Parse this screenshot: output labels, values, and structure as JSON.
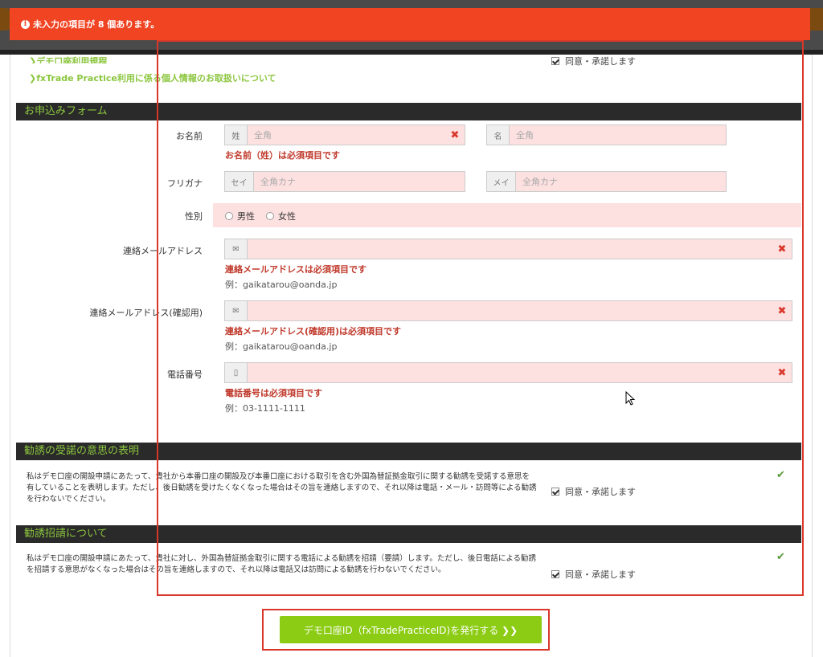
{
  "alert": {
    "icon": "info-icon",
    "text": "未入力の項目が 8 個あります。"
  },
  "links": {
    "terms": "デモ口座利用規程",
    "privacy": "fxTrade Practice利用に係る個人情報のお取扱いについて"
  },
  "agree_label": "同意・承諾します",
  "sections": {
    "form": "お申込みフォーム",
    "solicitation": "勧誘の受諾の意思の表明",
    "invitation": "勧誘招請について"
  },
  "form": {
    "name": {
      "label": "お名前",
      "last_addon": "姓",
      "last_placeholder": "全角",
      "first_addon": "名",
      "first_placeholder": "全角",
      "error": "お名前（姓）は必須項目です"
    },
    "furigana": {
      "label": "フリガナ",
      "last_addon": "セイ",
      "last_placeholder": "全角カナ",
      "first_addon": "メイ",
      "first_placeholder": "全角カナ"
    },
    "gender": {
      "label": "性別",
      "options": [
        "男性",
        "女性"
      ]
    },
    "email": {
      "label": "連絡メールアドレス",
      "error": "連絡メールアドレスは必須項目です",
      "example": "例：gaikatarou@oanda.jp"
    },
    "email_confirm": {
      "label": "連絡メールアドレス(確認用)",
      "error": "連絡メールアドレス(確認用)は必須項目です",
      "example": "例：gaikatarou@oanda.jp"
    },
    "phone": {
      "label": "電話番号",
      "error": "電話番号は必須項目です",
      "example": "例：03-1111-1111"
    }
  },
  "solicitation_text": "私はデモ口座の開設申請にあたって、貴社から本番口座の開設及び本番口座における取引を含む外国為替証拠金取引に関する勧誘を受諾する意思を有していることを表明します。ただし、後日勧誘を受けたくなくなった場合はその旨を連絡しますので、それ以降は電話・メール・訪問等による勧誘を行わないでください。",
  "invitation_text": "私はデモ口座の開設申請にあたって、貴社に対し、外国為替証拠金取引に関する電話による勧誘を招請（要請）します。ただし、後日電話による勧誘を招請する意思がなくなった場合はその旨を連絡しますので、それ以降は電話又は訪問による勧誘を行わないでください。",
  "submit_label": "デモ口座ID（fxTradePracticeID)を発行する ❯❯",
  "colors": {
    "alert": "#f04423",
    "accent": "#8cc63f",
    "error": "#c0392b",
    "field_bg": "#fde0e0",
    "highlight": "#d9372a"
  }
}
